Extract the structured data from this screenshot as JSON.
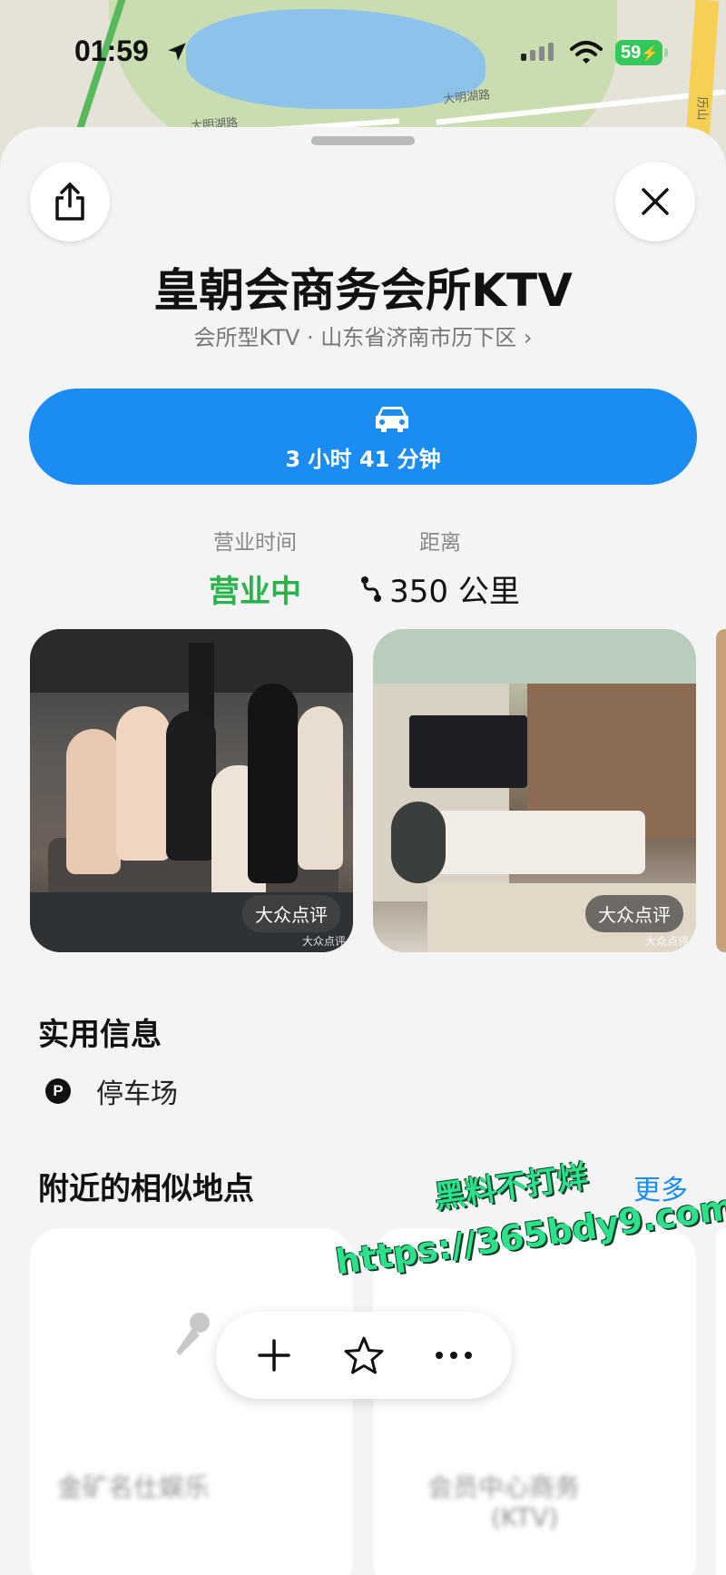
{
  "status_bar": {
    "time": "01:59",
    "battery": "59"
  },
  "map": {
    "labels": [
      "大明湖路",
      "大明湖路",
      "历山"
    ]
  },
  "place": {
    "title": "皇朝会商务会所KTV",
    "subtitle": "会所型KTV · 山东省济南市历下区 ›"
  },
  "directions": {
    "duration": "3 小时 41 分钟"
  },
  "info": {
    "hours_label": "营业时间",
    "hours_value": "营业中",
    "distance_label": "距离",
    "distance_value": "350 公里"
  },
  "photos": [
    {
      "badge": "大众点评",
      "watermark": "大众点评"
    },
    {
      "badge": "大众点评",
      "watermark": "大众点评"
    }
  ],
  "useful_info": {
    "title": "实用信息",
    "items": [
      {
        "icon": "P",
        "label": "停车场"
      }
    ]
  },
  "nearby": {
    "title": "附近的相似地点",
    "more": "更多",
    "cards": [
      {
        "name": "金矿名仕娱乐"
      },
      {
        "name": "会员中心商务",
        "sub": "(KTV)"
      }
    ]
  },
  "overlay": {
    "line1": "黑料不打烊",
    "line2": "https://365bdy9.com"
  },
  "colors": {
    "accent": "#1a8cf2",
    "open_green": "#2bb24c"
  }
}
